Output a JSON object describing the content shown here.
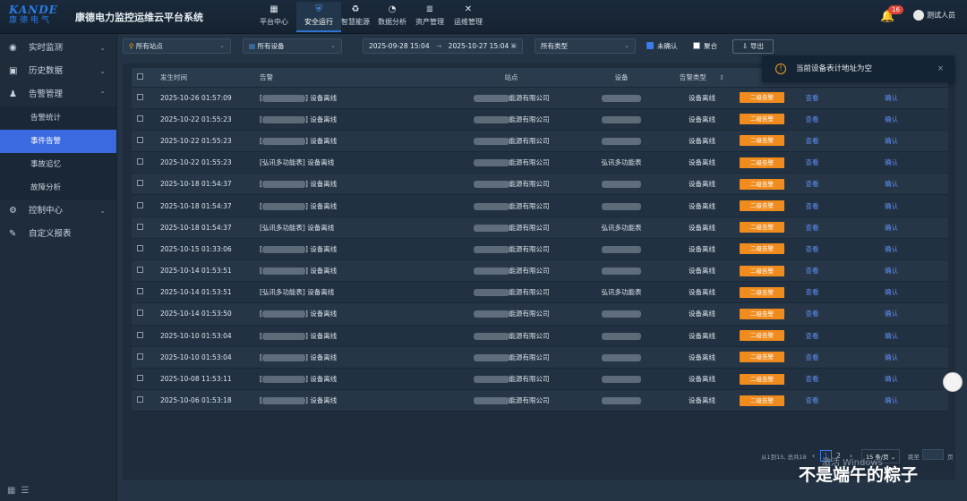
{
  "header": {
    "logo_text": "KANDE",
    "logo_sub": "康德电气",
    "system_title": "康德电力监控运维云平台系统",
    "nav": [
      {
        "label": "平台中心",
        "icon": "grid-icon"
      },
      {
        "label": "安全运行",
        "icon": "shield-icon",
        "active": true
      },
      {
        "label": "智慧能源",
        "icon": "recycle-icon"
      },
      {
        "label": "数据分析",
        "icon": "pie-chart-icon"
      },
      {
        "label": "资产管理",
        "icon": "database-icon"
      },
      {
        "label": "运维管理",
        "icon": "tools-icon"
      }
    ],
    "notification_count": "16",
    "user_name": "测试人员"
  },
  "sidebar": {
    "items": [
      {
        "label": "实时监测",
        "icon": "monitor-icon"
      },
      {
        "label": "历史数据",
        "icon": "calendar-icon"
      },
      {
        "label": "告警管理",
        "icon": "alarm-icon",
        "expanded": true
      }
    ],
    "sub_items": [
      "告警统计",
      "事件告警",
      "事故追忆",
      "故障分析"
    ],
    "items_after": [
      {
        "label": "控制中心",
        "icon": "gear-icon"
      },
      {
        "label": "自定义报表",
        "icon": "edit-icon"
      }
    ]
  },
  "filters": {
    "site": "所有站点",
    "device": "所有设备",
    "date_start": "2025-09-28 15:04",
    "date_end": "2025-10-27 15:04",
    "type": "所有类型",
    "unconfirmed_label": "未确认",
    "merge_label": "聚合",
    "export_label": "导出"
  },
  "table": {
    "headers": [
      "发生时间",
      "告警",
      "站点",
      "设备",
      "告警类型",
      ""
    ],
    "rows": [
      {
        "time": "2025-10-26 01:57:09",
        "alarm": "设备离线",
        "site": "能源有限公司",
        "device": "",
        "type": "设备离线",
        "level": "二级告警",
        "view": "查看",
        "confirm": "确认"
      },
      {
        "time": "2025-10-22 01:55:23",
        "alarm": "设备离线",
        "site": "能源有限公司",
        "device": "",
        "type": "设备离线",
        "level": "二级告警",
        "view": "查看",
        "confirm": "确认"
      },
      {
        "time": "2025-10-22 01:55:23",
        "alarm": "设备离线",
        "site": "能源有限公司",
        "device": "",
        "type": "设备离线",
        "level": "二级告警",
        "view": "查看",
        "confirm": "确认"
      },
      {
        "time": "2025-10-22 01:55:23",
        "alarm": "[弘讯多功能表] 设备离线",
        "site": "能源有限公司",
        "device": "弘讯多功能表",
        "type": "设备离线",
        "level": "二级告警",
        "view": "查看",
        "confirm": "确认"
      },
      {
        "time": "2025-10-18 01:54:37",
        "alarm": "设备离线",
        "site": "能源有限公司",
        "device": "",
        "type": "设备离线",
        "level": "二级告警",
        "view": "查看",
        "confirm": "确认"
      },
      {
        "time": "2025-10-18 01:54:37",
        "alarm": "设备离线",
        "site": "能源有限公司",
        "device": "",
        "type": "设备离线",
        "level": "二级告警",
        "view": "查看",
        "confirm": "确认"
      },
      {
        "time": "2025-10-18 01:54:37",
        "alarm": "[弘讯多功能表] 设备离线",
        "site": "能源有限公司",
        "device": "弘讯多功能表",
        "type": "设备离线",
        "level": "二级告警",
        "view": "查看",
        "confirm": "确认"
      },
      {
        "time": "2025-10-15 01:33:06",
        "alarm": "设备离线",
        "site": "能源有限公司",
        "device": "",
        "type": "设备离线",
        "level": "二级告警",
        "view": "查看",
        "confirm": "确认"
      },
      {
        "time": "2025-10-14 01:53:51",
        "alarm": "设备离线",
        "site": "能源有限公司",
        "device": "",
        "type": "设备离线",
        "level": "二级告警",
        "view": "查看",
        "confirm": "确认"
      },
      {
        "time": "2025-10-14 01:53:51",
        "alarm": "[弘讯多功能表] 设备离线",
        "site": "能源有限公司",
        "device": "弘讯多功能表",
        "type": "设备离线",
        "level": "二级告警",
        "view": "查看",
        "confirm": "确认"
      },
      {
        "time": "2025-10-14 01:53:50",
        "alarm": "设备离线",
        "site": "能源有限公司",
        "device": "",
        "type": "设备离线",
        "level": "二级告警",
        "view": "查看",
        "confirm": "确认"
      },
      {
        "time": "2025-10-10 01:53:04",
        "alarm": "设备离线",
        "site": "能源有限公司",
        "device": "",
        "type": "设备离线",
        "level": "二级告警",
        "view": "查看",
        "confirm": "确认"
      },
      {
        "time": "2025-10-10 01:53:04",
        "alarm": "设备离线",
        "site": "能源有限公司",
        "device": "",
        "type": "设备离线",
        "level": "二级告警",
        "view": "查看",
        "confirm": "确认"
      },
      {
        "time": "2025-10-08 11:53:11",
        "alarm": "设备离线",
        "site": "能源有限公司",
        "device": "",
        "type": "设备离线",
        "level": "二级告警",
        "view": "查看",
        "confirm": "确认"
      },
      {
        "time": "2025-10-06 01:53:18",
        "alarm": "设备离线",
        "site": "能源有限公司",
        "device": "",
        "type": "设备离线",
        "level": "二级告警",
        "view": "查看",
        "confirm": "确认"
      }
    ]
  },
  "pagination": {
    "summary": "从1到15, 总共18",
    "pages": [
      "1",
      "2"
    ],
    "page_size": "15 条/页",
    "goto_label": "跳至",
    "page_unit": "页"
  },
  "toast": {
    "message": "当前设备表计地址为空"
  },
  "watermark": {
    "activate": "激活 Windows",
    "author": "不是端午的粽子"
  },
  "colors": {
    "accent": "#3b6ae0",
    "alarm_tag": "#f08c1e",
    "link": "#5d8df0"
  }
}
